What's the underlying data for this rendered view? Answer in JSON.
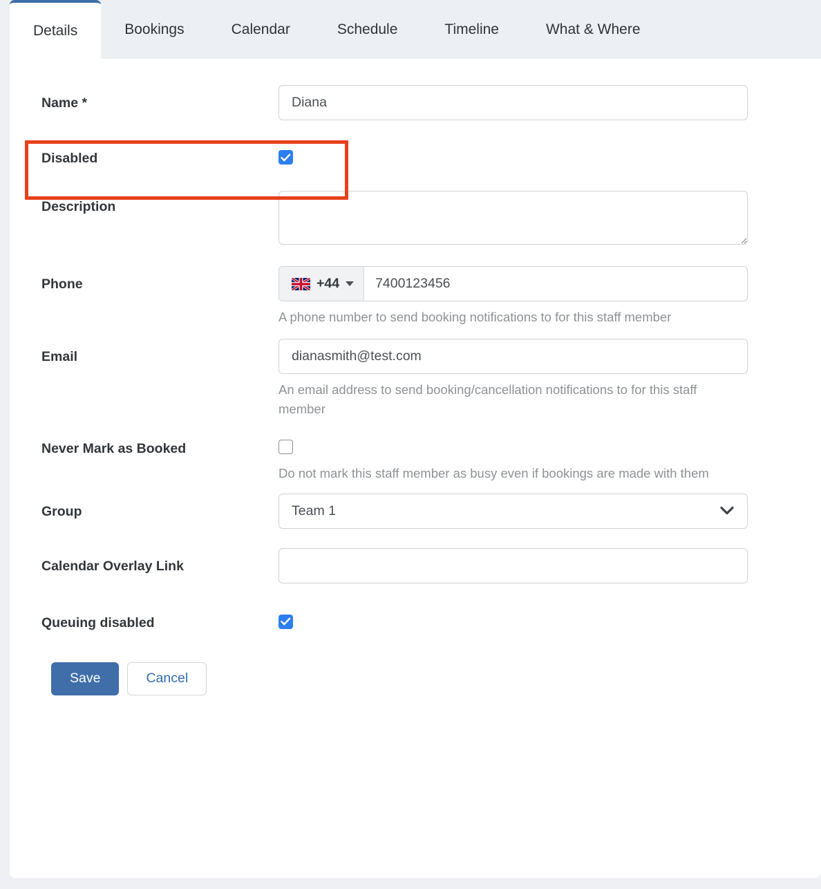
{
  "tabs": [
    {
      "label": "Details",
      "active": true
    },
    {
      "label": "Bookings",
      "active": false
    },
    {
      "label": "Calendar",
      "active": false
    },
    {
      "label": "Schedule",
      "active": false
    },
    {
      "label": "Timeline",
      "active": false
    },
    {
      "label": "What & Where",
      "active": false
    }
  ],
  "form": {
    "name": {
      "label": "Name *",
      "value": "Diana",
      "placeholder": ""
    },
    "disabled": {
      "label": "Disabled",
      "checked": true,
      "highlighted": true
    },
    "description": {
      "label": "Description",
      "value": "",
      "placeholder": ""
    },
    "phone": {
      "label": "Phone",
      "country_code": "+44",
      "flag": "uk-flag-icon",
      "value": "7400123456",
      "placeholder": "",
      "help": "A phone number to send booking notifications to for this staff member"
    },
    "email": {
      "label": "Email",
      "value": "dianasmith@test.com",
      "placeholder": "",
      "help": "An email address to send booking/cancellation notifications to for this staff member"
    },
    "never_mark_as_booked": {
      "label": "Never Mark as Booked",
      "checked": false,
      "help": "Do not mark this staff member as busy even if bookings are made with them"
    },
    "group": {
      "label": "Group",
      "value": "Team 1",
      "options": [
        "Team 1"
      ]
    },
    "calendar_overlay_link": {
      "label": "Calendar Overlay Link",
      "value": "",
      "placeholder": ""
    },
    "queuing_disabled": {
      "label": "Queuing disabled",
      "checked": true
    }
  },
  "actions": {
    "save_label": "Save",
    "cancel_label": "Cancel"
  },
  "colors": {
    "accent_blue": "#3f6ea8",
    "checkbox_blue": "#2d7ff0",
    "annotation_red": "#e8401c",
    "page_bg": "#eef0f4",
    "tabstrip_bg": "#eceff3",
    "link_blue": "#2f6bb5",
    "help_text": "#8e9296"
  }
}
